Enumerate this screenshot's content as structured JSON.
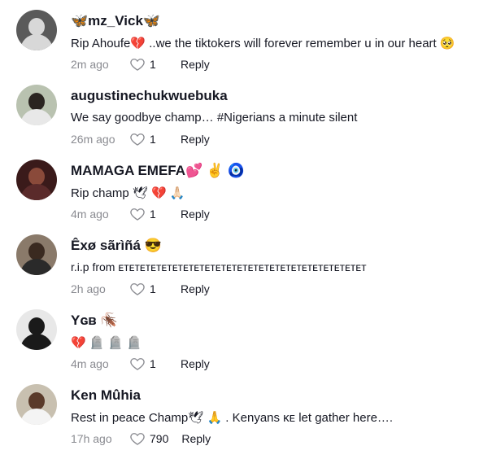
{
  "comments": [
    {
      "username": "🦋mz_Vick🦋",
      "text": "Rip Ahoufe💔 ..we the tiktokers will forever remember u in our heart 🥺",
      "time": "2m ago",
      "likes": "1",
      "reply": "Reply",
      "avatar_colors": {
        "bg": "#5a5a5a",
        "fg": "#d8d8d8"
      }
    },
    {
      "username": "augustinechukwuebuka",
      "text": "We say goodbye champ… #Nigerians a minute silent",
      "time": "26m ago",
      "likes": "1",
      "reply": "Reply",
      "avatar_colors": {
        "bg": "#b9c2b0",
        "fg": "#2a2420"
      }
    },
    {
      "username": "MAMAGA EMEFA💕 ✌️ 🧿",
      "text": "Rip champ 🕊 💔 🙏🏻",
      "time": "4m ago",
      "likes": "1",
      "reply": "Reply",
      "avatar_colors": {
        "bg": "#3a1a1a",
        "fg": "#8a4a3a"
      }
    },
    {
      "username": "Êxø sãrìñá 😎",
      "text": "r.i.p from ᴇᴛᴇᴛᴇᴛᴇᴛᴇᴛᴇᴛᴇᴛᴇᴛᴇᴛᴇᴛᴇᴛᴇᴛᴇᴛᴇᴛᴇᴛᴇᴛᴇᴛᴇᴛᴇᴛᴇᴛᴇᴛᴇᴛᴇᴛ",
      "time": "2h ago",
      "likes": "1",
      "reply": "Reply",
      "avatar_colors": {
        "bg": "#8a7a6a",
        "fg": "#3a2a20"
      }
    },
    {
      "username": "Yɢʙ 🪳",
      "text": "💔 🪦 🪦 🪦",
      "time": "4m ago",
      "likes": "1",
      "reply": "Reply",
      "avatar_colors": {
        "bg": "#e8e8e8",
        "fg": "#1a1a1a"
      }
    },
    {
      "username": "Ken Mûhia",
      "text": "Rest in peace Champ🕊 🙏 . Kenyans ᴋᴇ let gather here….",
      "time": "17h ago",
      "likes": "790",
      "reply": "Reply",
      "avatar_colors": {
        "bg": "#c8c0b0",
        "fg": "#f4f4f4"
      }
    }
  ]
}
